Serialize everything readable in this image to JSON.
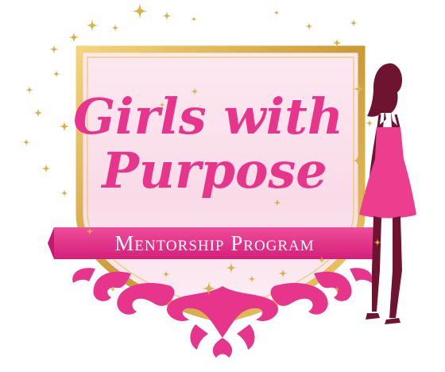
{
  "logo": {
    "title_line1": "Girls with",
    "title_line2": "Purpose",
    "banner": "Mentorship Program"
  },
  "colors": {
    "primary_pink": "#e6358a",
    "title_pink": "#e8358c",
    "gold": "#d8b24a",
    "gold_dark": "#b8862a",
    "shield_fill": "#fbe6ef",
    "silhouette_dark": "#6e1430",
    "dress_pink": "#ec3d8f",
    "banner_text": "#ffffff"
  },
  "icons": {
    "sparkle": "sparkle-icon",
    "silhouette": "woman-silhouette-icon",
    "damask": "damask-ornament-icon"
  }
}
